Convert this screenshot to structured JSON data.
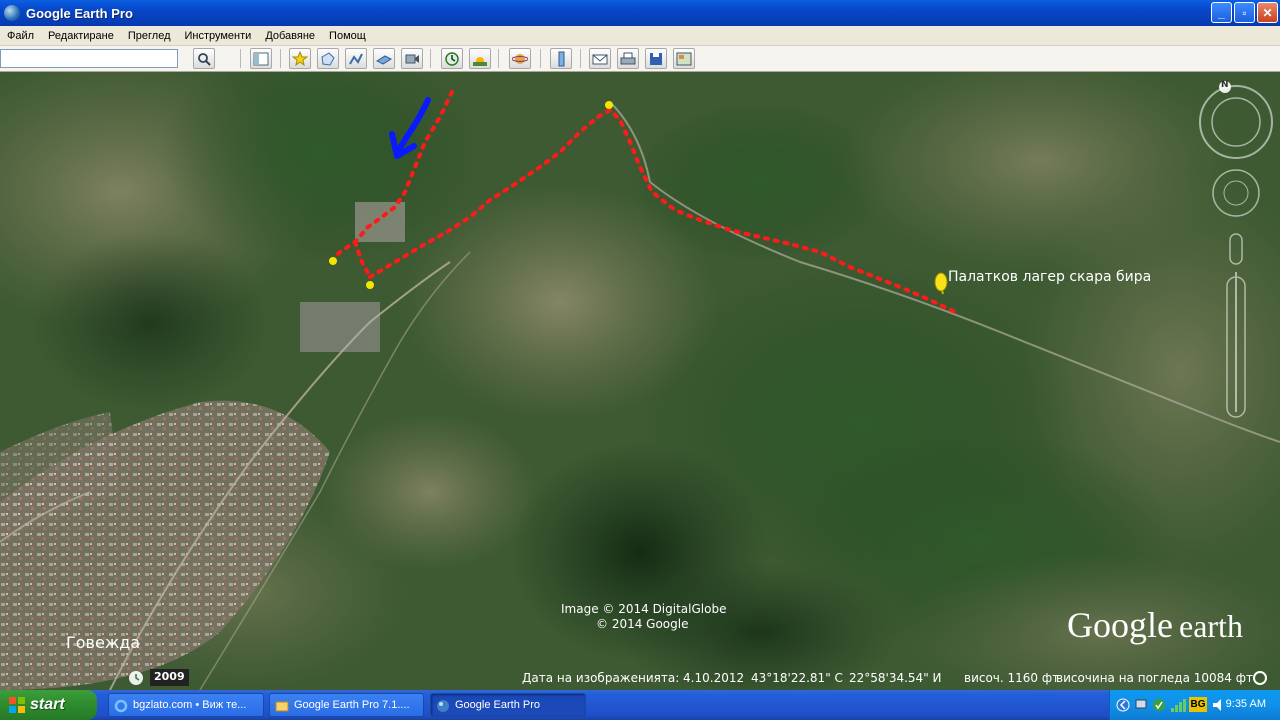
{
  "window": {
    "title": "Google Earth Pro",
    "minimize": "_",
    "maximize": "▫",
    "close": "✕"
  },
  "menu": [
    "Файл",
    "Редактиране",
    "Преглед",
    "Инструменти",
    "Добавяне",
    "Помощ"
  ],
  "search": {
    "value": "",
    "placeholder": ""
  },
  "toolbar_icons": [
    "search-icon",
    "sidebar-toggle-icon",
    "placemark-icon",
    "polygon-icon",
    "path-icon",
    "overlay-icon",
    "tour-icon",
    "history-icon",
    "sunlight-icon",
    "planets-icon",
    "ruler-icon",
    "email-icon",
    "print-icon",
    "save-image-icon",
    "view-in-maps-icon"
  ],
  "map": {
    "placemark_label": "Палатков лагер скара бира",
    "town_label": "Говежда",
    "credit_line1": "Image © 2014 DigitalGlobe",
    "credit_line2": "© 2014 Google",
    "brand_google": "Google",
    "brand_earth": "earth",
    "compass_n": "N",
    "history_year": "2009",
    "colors": {
      "route": "#ff1a1a",
      "pin": "#f5e600",
      "arrow": "#0a1aff"
    }
  },
  "status": {
    "imagery_date": "Дата на изображенията: 4.10.2012",
    "lat": "43°18'22.81\" С",
    "lon": "22°58'34.54\" И",
    "elev": "височ.  1160 фт",
    "eye_alt": "височина на погледа  10084 фт"
  },
  "taskbar": {
    "start": "start",
    "tasks": [
      {
        "label": "bgzlato.com • Виж те...",
        "icon": "ie-icon"
      },
      {
        "label": "Google Earth Pro 7.1....",
        "icon": "folder-icon"
      },
      {
        "label": "Google Earth Pro",
        "icon": "google-earth-icon"
      }
    ],
    "tray_badge": "BG",
    "clock": "9:35 AM"
  }
}
